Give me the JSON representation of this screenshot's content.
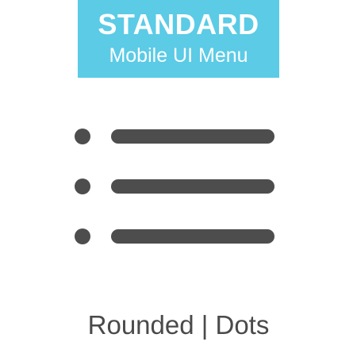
{
  "banner": {
    "title": "STANDARD",
    "subtitle": "Mobile UI Menu"
  },
  "menu_icon": {
    "name": "hamburger-menu-icon",
    "rows": 3
  },
  "caption": "Rounded | Dots",
  "colors": {
    "banner_background": "#5bcbe6",
    "banner_text": "#ffffff",
    "icon": "#4d4d4d",
    "caption": "#4a4a4a"
  }
}
